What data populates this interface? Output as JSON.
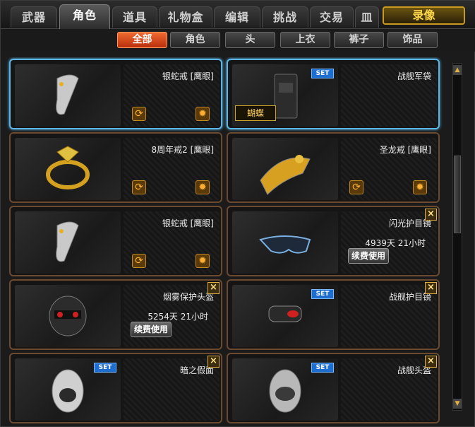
{
  "tabs": [
    "武器",
    "角色",
    "道具",
    "礼物盒",
    "编辑",
    "挑战",
    "交易",
    "皿"
  ],
  "record_button": "录像",
  "subtabs": [
    "全部",
    "角色",
    "头",
    "上衣",
    "裤子",
    "饰品"
  ],
  "items": [
    {
      "name": "银蛇戒 [鹰眼]"
    },
    {
      "name": "战舰军袋",
      "badge": "SET",
      "tag": "蝴蝶"
    },
    {
      "name": "8周年戒2 [鹰眼]"
    },
    {
      "name": "圣龙戒 [鹰眼]"
    },
    {
      "name": "银蛇戒 [鹰眼]"
    },
    {
      "name": "闪光护目镜",
      "time": "4939天  21小时",
      "renew": "续费使用",
      "close": "×"
    },
    {
      "name": "烟雾保护头盔",
      "time": "5254天  21小时",
      "renew": "续费使用",
      "close": "×"
    },
    {
      "name": "战舰护目镜",
      "badge": "SET",
      "close": "×"
    },
    {
      "name": "暗之假面",
      "badge": "SET",
      "close": "×"
    },
    {
      "name": "战舰头盔",
      "badge": "SET",
      "close": "×"
    }
  ],
  "icons": {
    "refresh": "refresh-icon",
    "settings": "gear-icon",
    "scroll_up": "arrow-up-icon",
    "scroll_down": "arrow-down-icon"
  },
  "colors": {
    "accent": "#e8541c",
    "selected_border": "#5ab4e6",
    "card_border": "#6b4a30",
    "gold": "#e0b040"
  }
}
